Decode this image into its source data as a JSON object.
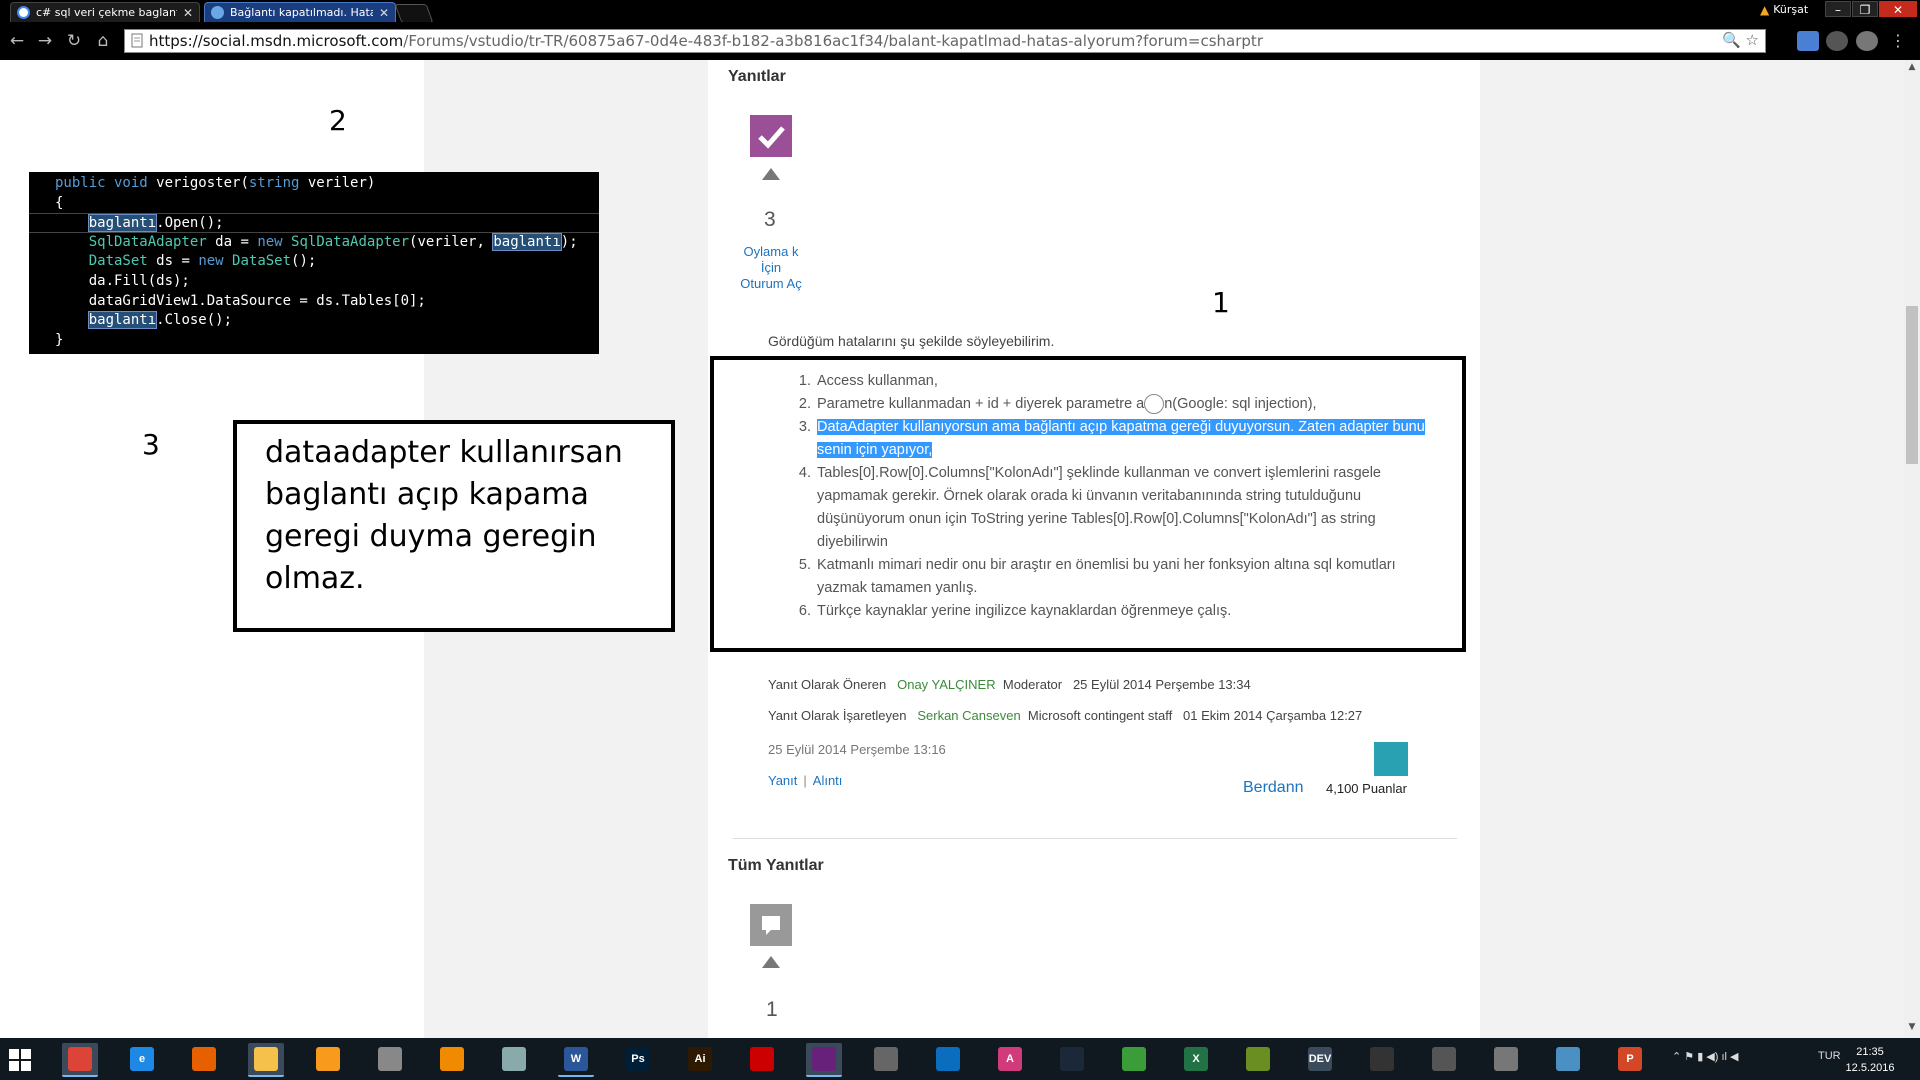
{
  "browser": {
    "tabs": [
      {
        "title": "c# sql veri çekme baglantı",
        "favicon": "google-icon",
        "active": false
      },
      {
        "title": "Bağlantı kapatılmadı. Hata",
        "favicon": "msdn-icon",
        "active": true
      }
    ],
    "user": "Kürşat",
    "url_host": "https://social.msdn.microsoft.com",
    "url_rest": "/Forums/vstudio/tr-TR/60875a67-0d4e-483f-b182-a3b816ac1f34/balant-kapatlmad-hatas-alyorum?forum=csharptr"
  },
  "annotations": {
    "label_1": "1",
    "label_2": "2",
    "label_3": "3",
    "note_lines": [
      "dataadapter kullanırsan",
      "baglantı açıp kapama",
      "geregi duyma geregin",
      "olmaz."
    ]
  },
  "code": {
    "lines": [
      [
        {
          "t": "public void ",
          "c": "kw"
        },
        {
          "t": "verigoster("
        },
        {
          "t": "string",
          "c": "kw"
        },
        {
          "t": " veriler)"
        }
      ],
      [
        {
          "t": "{"
        }
      ],
      [
        {
          "t": "    "
        },
        {
          "t": "baglantı",
          "c": "hl"
        },
        {
          "t": ".Open();"
        }
      ],
      [
        {
          "t": "    "
        },
        {
          "t": "SqlDataAdapter",
          "c": "ty"
        },
        {
          "t": " da = "
        },
        {
          "t": "new ",
          "c": "kw"
        },
        {
          "t": "SqlDataAdapter",
          "c": "ty"
        },
        {
          "t": "(veriler, "
        },
        {
          "t": "baglantı",
          "c": "hl"
        },
        {
          "t": ");"
        }
      ],
      [
        {
          "t": "    "
        },
        {
          "t": "DataSet",
          "c": "ty"
        },
        {
          "t": " ds = "
        },
        {
          "t": "new ",
          "c": "kw"
        },
        {
          "t": "DataSet",
          "c": "ty"
        },
        {
          "t": "();"
        }
      ],
      [
        {
          "t": "    da.Fill(ds);"
        }
      ],
      [
        {
          "t": "    dataGridView1.DataSource = ds.Tables[0];"
        }
      ],
      [
        {
          "t": "    "
        },
        {
          "t": "baglantı",
          "c": "hl"
        },
        {
          "t": ".Close();"
        }
      ],
      [
        {
          "t": "}"
        }
      ]
    ]
  },
  "forum": {
    "answers_title": "Yanıtlar",
    "vote_count": "3",
    "signin_text": "Oylama k İçin Oturum Aç",
    "intro": "Gördüğüm hatalarını şu şekilde söyleyebilirim.",
    "items": [
      "Access kullanman,",
      "Parametre kullanmadan + id + diyerek parametre a",
      "DataAdapter kullanıyorsun ama bağlantı açıp kapatma gereği duyuyorsun. Zaten adapter bunu senin için yapıyor,",
      "Tables[0].Row[0].Columns[\"KolonAdı\"] şeklinde kullanman ve convert işlemlerini rasgele yapmamak gerekir. Örnek olarak orada ki ünvanın veritabanınında string tutulduğunu düşünüyorum onun için ToString yerine Tables[0].Row[0].Columns[\"KolonAdı\"] as string diyebilirwin",
      "Katmanlı mimari nedir onu bir araştır en önemlisi bu yani her fonksyion altına sql komutları yazmak tamamen yanlış.",
      "Türkçe kaynaklar yerine ingilizce kaynaklardan öğrenmeye çalış."
    ],
    "item2_suffix": "n(Google: sql injection),",
    "proposed_label": "Yanıt Olarak Öneren",
    "proposed_user": "Onay YALÇINER",
    "proposed_role": "Moderator",
    "proposed_date": "25 Eylül 2014 Perşembe 13:34",
    "marked_label": "Yanıt Olarak İşaretleyen",
    "marked_user": "Serkan Canseven",
    "marked_role": "Microsoft contingent staff",
    "marked_date": "01 Ekim 2014 Çarşamba 12:27",
    "post_date": "25 Eylül 2014 Perşembe 13:16",
    "reply_link": "Yanıt",
    "quote_link": "Alıntı",
    "author": "Berdann",
    "points": "4,100 Puanlar",
    "all_answers_title": "Tüm Yanıtlar",
    "all_vote_count": "1"
  },
  "taskbar": {
    "apps": [
      {
        "name": "chrome",
        "color": "#db4437",
        "glyph": "",
        "running": true,
        "active": true
      },
      {
        "name": "internet-explorer",
        "color": "#1e88e5",
        "glyph": "e",
        "running": false
      },
      {
        "name": "firefox",
        "color": "#e66000",
        "glyph": "",
        "running": false
      },
      {
        "name": "file-explorer",
        "color": "#f6c14b",
        "glyph": "",
        "running": true,
        "active": true
      },
      {
        "name": "app-orange",
        "color": "#f89a1c",
        "glyph": "",
        "running": false
      },
      {
        "name": "app-tools",
        "color": "#888",
        "glyph": "",
        "running": false
      },
      {
        "name": "vlc",
        "color": "#f08a00",
        "glyph": "",
        "running": false
      },
      {
        "name": "paint",
        "color": "#8aa",
        "glyph": "",
        "running": false
      },
      {
        "name": "word",
        "color": "#2b579a",
        "glyph": "W",
        "running": true
      },
      {
        "name": "photoshop",
        "color": "#001e36",
        "glyph": "Ps",
        "running": false
      },
      {
        "name": "illustrator",
        "color": "#2e1a00",
        "glyph": "Ai",
        "running": false
      },
      {
        "name": "acrobat",
        "color": "#c00",
        "glyph": "",
        "running": false
      },
      {
        "name": "visual-studio",
        "color": "#68217a",
        "glyph": "",
        "running": true,
        "active": true
      },
      {
        "name": "app-wrench",
        "color": "#666",
        "glyph": "",
        "running": false
      },
      {
        "name": "vs-code",
        "color": "#0a6dbd",
        "glyph": "",
        "running": false
      },
      {
        "name": "app-a",
        "color": "#d23b7b",
        "glyph": "A",
        "running": false
      },
      {
        "name": "steam",
        "color": "#1b2838",
        "glyph": "",
        "running": false
      },
      {
        "name": "app-globe",
        "color": "#3a9d3a",
        "glyph": "",
        "running": false
      },
      {
        "name": "excel",
        "color": "#217346",
        "glyph": "X",
        "running": false
      },
      {
        "name": "app-chart",
        "color": "#6b8e23",
        "glyph": "",
        "running": false
      },
      {
        "name": "devexpress",
        "color": "#3c4b5c",
        "glyph": "DEV",
        "running": false
      },
      {
        "name": "app-dark",
        "color": "#333",
        "glyph": "",
        "running": false
      },
      {
        "name": "calculator",
        "color": "#555",
        "glyph": "",
        "running": false
      },
      {
        "name": "app-disc",
        "color": "#777",
        "glyph": "",
        "running": false
      },
      {
        "name": "app-edit",
        "color": "#4a90c2",
        "glyph": "",
        "running": false
      },
      {
        "name": "powerpoint",
        "color": "#d24726",
        "glyph": "P",
        "running": false
      }
    ],
    "lang": "TUR",
    "time": "21:35",
    "date": "12.5.2016"
  }
}
